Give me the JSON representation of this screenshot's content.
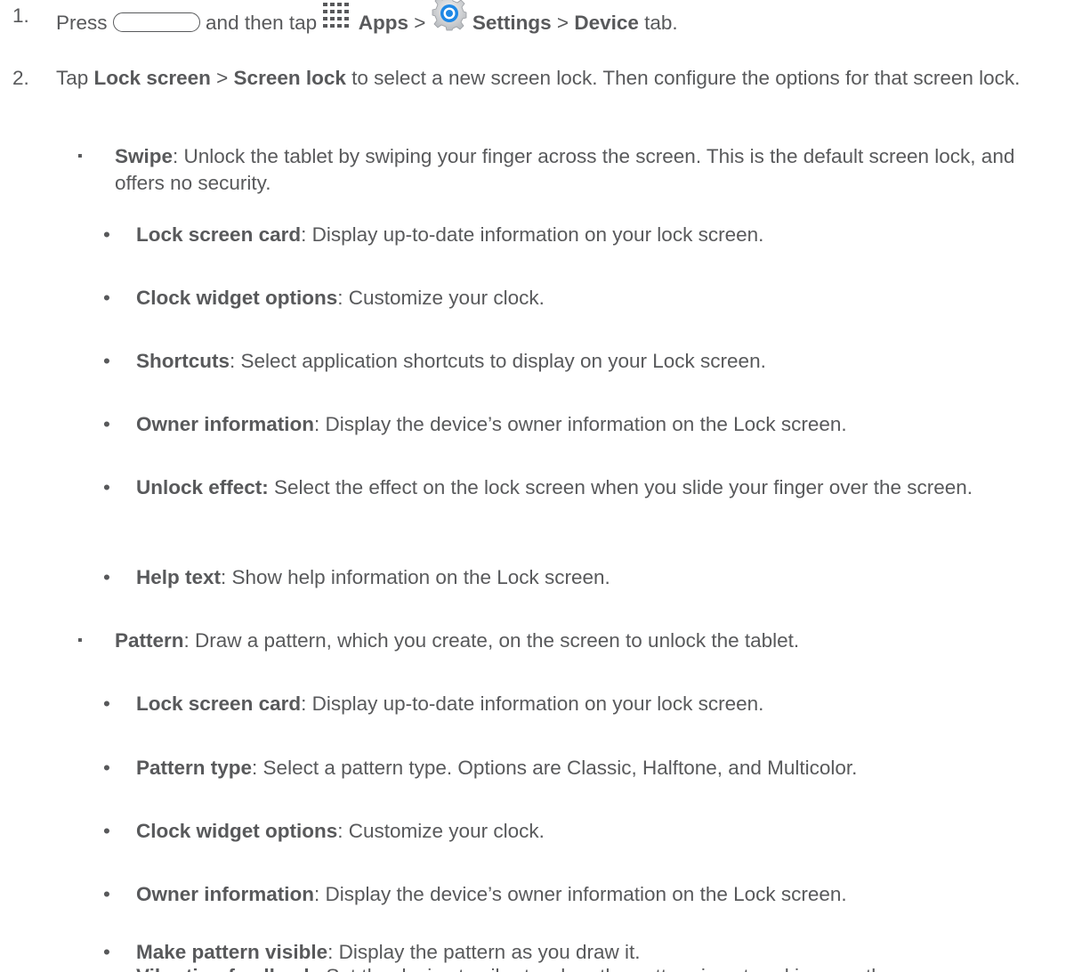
{
  "steps": [
    {
      "number": "1.",
      "press": "Press",
      "then_tap": "and then tap",
      "apps": "Apps",
      "sep1": ">",
      "settings": "Settings",
      "sep2": ">",
      "device": "Device",
      "tab": "tab."
    },
    {
      "number": "2.",
      "tap": "Tap",
      "lock_screen": "Lock screen",
      "sep": ">",
      "screen_lock": "Screen lock",
      "rest": "to select a new screen lock. Then configure the options for that screen lock."
    }
  ],
  "swipe": {
    "bullet": "▪",
    "label": "Swipe",
    "text": ": Unlock the tablet by swiping your finger across the screen. This is the default screen lock, and offers no security.",
    "options": [
      {
        "label": "Lock screen card",
        "text": ": Display up-to-date information on your lock screen."
      },
      {
        "label": "Clock widget options",
        "text": ": Customize your clock."
      },
      {
        "label": "Shortcuts",
        "text": ": Select application shortcuts to display on your Lock screen."
      },
      {
        "label": "Owner information",
        "text": ": Display the device’s owner information on the Lock screen."
      },
      {
        "label": "Unlock effect:",
        "text": " Select the effect on the lock screen when you slide your finger over the screen."
      },
      {
        "label": "Help text",
        "text": ": Show help information on the Lock screen."
      }
    ]
  },
  "pattern": {
    "bullet": "▪",
    "label": "Pattern",
    "text": ": Draw a pattern, which you create, on the screen to unlock the tablet.",
    "options": [
      {
        "label": "Lock screen card",
        "text": ": Display up-to-date information on your lock screen."
      },
      {
        "label": "Pattern type",
        "text": ": Select a pattern type. Options are Classic, Halftone, and Multicolor."
      },
      {
        "label": "Clock widget options",
        "text": ": Customize your clock."
      },
      {
        "label": "Owner information",
        "text": ": Display the device’s owner information on the Lock screen."
      },
      {
        "label": "Make pattern visible",
        "text": ": Display the pattern as you draw it."
      },
      {
        "label": "Vibration feedback",
        "text": ": Set the device to vibrate when the pattern is entered incorrectly."
      }
    ]
  },
  "sub_bullet": "•",
  "colors": {
    "text": "#58595b",
    "settings_icon_blue": "#1e88e5"
  },
  "icons": [
    "home-key-icon",
    "apps-grid-icon",
    "settings-gear-icon"
  ]
}
